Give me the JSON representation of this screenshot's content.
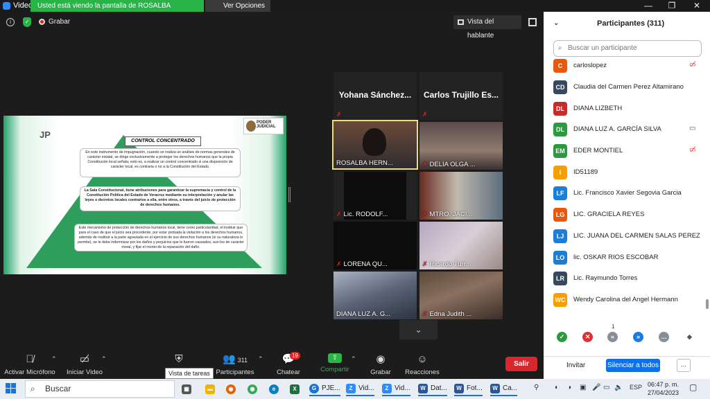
{
  "titlebar": {
    "app_name": "Video",
    "share_banner": "Usted está viendo la pantalla de ROSALBA HERNANDEZ",
    "view_options": "Ver Opciones",
    "minimize": "—",
    "maximize": "❐",
    "close": "✕"
  },
  "meeting": {
    "record_label": "Grabar",
    "view_label": "Vista del hablante"
  },
  "slide": {
    "jp": "JP",
    "logo_text": "PODER JUDICIAL",
    "title": "CONTROL CONCENTRADO",
    "paragraph1": "En este instrumento de impugnación, cuando se realiza un análisis de normas generales de carácter estatal, se dirige exclusivamente a proteger los derechos humanos que la propia Constitución local señala; esto es, a realizar un control concentrado si una disposición de carácter local, es contraria o no a la Constitución del Estado.",
    "paragraph2": "La Sala Constitucional, tiene atribuciones para garantizar la supremacía y control de la Constitución Política del Estado de Veracruz mediante su interpretación y anular las leyes o decretos locales contrarios a ella, entre otros, a través del juicio de protección de derechos humanos.",
    "paragraph3": "Este mecanismo de protección de derechos humanos local, tiene como particularidad, el instituir que para el caso de que el juicio sea procedente, por estar probada la violación a los derechos humanos, además de restituir a la parte agraviada en el ejercicio de sus derechos humanos (si su naturaleza lo permite), se le debe indemnizar por los daños y perjuicios que le fueron causados, aun los de carácter moral, y fijar el monto de la reparación del daño."
  },
  "gallery": {
    "tiles": [
      {
        "name": "Yohana Sánchez...",
        "type": "name-only"
      },
      {
        "name": "Carlos Trujillo Es...",
        "type": "name-only"
      },
      {
        "name": "ROSALBA HERN...",
        "type": "video"
      },
      {
        "name": "DELIA OLGA ...",
        "type": "video"
      },
      {
        "name": "Lic. RODOLF...",
        "type": "video"
      },
      {
        "name": "MTRO. JACI...",
        "type": "video"
      },
      {
        "name": "LORENA QU...",
        "type": "video"
      },
      {
        "name": "Ricardo Turr...",
        "type": "video"
      },
      {
        "name": "DIANA LUZ A. G...",
        "type": "video"
      },
      {
        "name": "Edna Judith ...",
        "type": "video"
      }
    ]
  },
  "toolbar": {
    "mic_label": "Activar Micrófono",
    "video_label": "Iniciar Video",
    "security_tooltip": "Vista de tareas",
    "participants_label": "Participantes",
    "participants_count": "311",
    "chat_label": "Chatear",
    "chat_badge": "19",
    "share_label": "Compartir",
    "record_label": "Grabar",
    "reactions_label": "Reacciones",
    "leave_label": "Salir"
  },
  "panel": {
    "title": "Participantes (311)",
    "search_placeholder": "Buscar un participante",
    "participants": [
      {
        "initials": "C",
        "name": "carloslopez",
        "color": "#e8590c",
        "status": "video-off"
      },
      {
        "initials": "CD",
        "name": "Claudia del Carmen Perez Altamirano",
        "color": "#37495e",
        "status": ""
      },
      {
        "initials": "DL",
        "name": "DIANA LIZBETH",
        "color": "#c92a2a",
        "status": ""
      },
      {
        "initials": "DL",
        "name": "DIANA LUZ A. GARCÍA SILVA",
        "color": "#2b9a3e",
        "status": "video-on"
      },
      {
        "initials": "EM",
        "name": "EDER MONTIEL",
        "color": "#2b9a3e",
        "status": "video-off"
      },
      {
        "initials": "I",
        "name": "ID51189",
        "color": "#f59f00",
        "status": ""
      },
      {
        "initials": "LF",
        "name": "Lic. Francisco Xavier Segovia Garcia",
        "color": "#1c7ed6",
        "status": ""
      },
      {
        "initials": "LG",
        "name": "LIC. GRACIELA REYES",
        "color": "#e8590c",
        "status": ""
      },
      {
        "initials": "LJ",
        "name": "LIC. JUANA DEL CARMEN SALAS PEREZ",
        "color": "#1c7ed6",
        "status": ""
      },
      {
        "initials": "LO",
        "name": "lic. OSKAR RIOS ESCOBAR",
        "color": "#1c7ed6",
        "status": ""
      },
      {
        "initials": "LR",
        "name": "Lic. Raymundo Torres",
        "color": "#37495e",
        "status": ""
      },
      {
        "initials": "WC",
        "name": "Wendy Carolina del Angel Hermann",
        "color": "#f59f00",
        "status": ""
      }
    ],
    "reaction_count": "1",
    "invite_label": "Invitar",
    "mute_all_label": "Silenciar a todos",
    "more_label": "..."
  },
  "taskbar": {
    "search_label": "Buscar",
    "apps": [
      {
        "label": "PJE...",
        "color": "#1a73d6",
        "glyph": "G"
      },
      {
        "label": "Vid...",
        "color": "#2d8cff",
        "glyph": "Z"
      },
      {
        "label": "Vid...",
        "color": "#2d8cff",
        "glyph": "Z"
      },
      {
        "label": "Dat...",
        "color": "#2b579a",
        "glyph": "W"
      },
      {
        "label": "Fot...",
        "color": "#2b579a",
        "glyph": "W"
      },
      {
        "label": "Ca...",
        "color": "#2b579a",
        "glyph": "W"
      }
    ],
    "language": "ESP",
    "time": "06:47 p. m.",
    "date": "27/04/2023"
  }
}
